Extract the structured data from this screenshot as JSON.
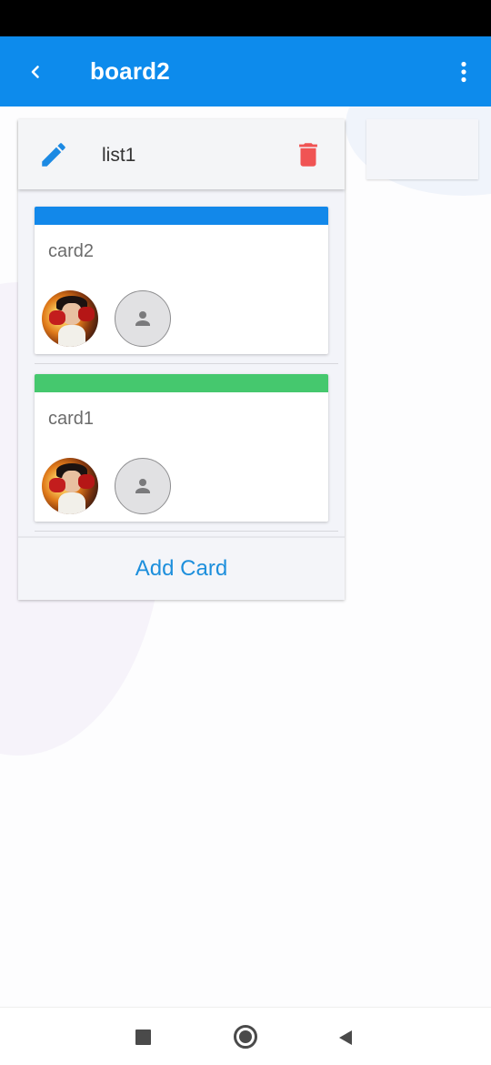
{
  "app_bar": {
    "title": "board2",
    "background_color": "#0d8bec",
    "back_icon": "chevron-left-icon",
    "menu_icon": "more-vert-icon"
  },
  "list": {
    "title": "list1",
    "edit_icon": "pencil-icon",
    "delete_icon": "trash-icon",
    "edit_icon_color": "#1c8ae3",
    "delete_icon_color": "#f05454",
    "cards": [
      {
        "title": "card2",
        "label_color": "#1288ea",
        "members": [
          "photo-avatar",
          "default-avatar"
        ]
      },
      {
        "title": "card1",
        "label_color": "#45c86e",
        "members": [
          "photo-avatar",
          "default-avatar"
        ]
      }
    ],
    "add_card_label": "Add Card",
    "add_card_color": "#1d8fdc"
  },
  "system_nav": {
    "recent_icon": "square-icon",
    "home_icon": "circle-icon",
    "back_icon": "triangle-back-icon"
  }
}
